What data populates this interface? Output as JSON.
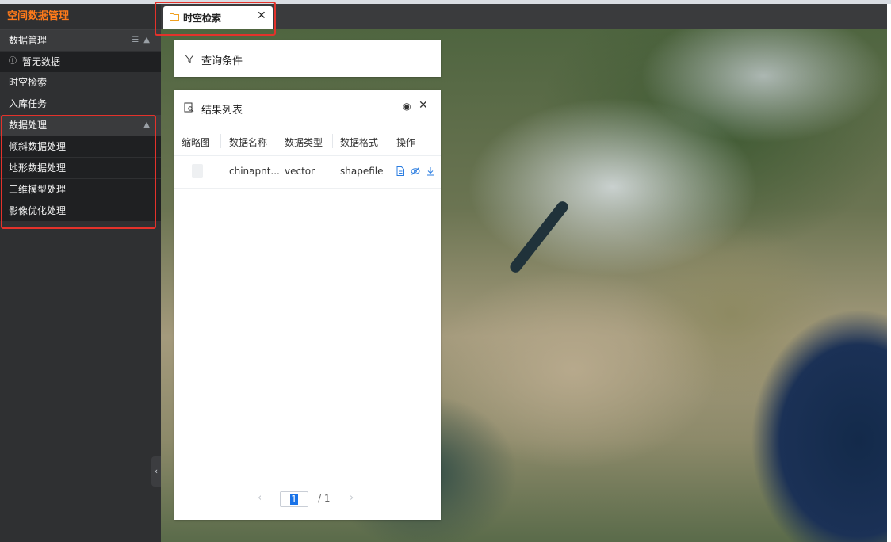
{
  "sidebar": {
    "app_title": "空间数据管理",
    "group_data_management": "数据管理",
    "no_data": "暂无数据",
    "items": [
      "时空检索",
      "入库任务"
    ],
    "group_data_processing": "数据处理",
    "processing_items": [
      "倾斜数据处理",
      "地形数据处理",
      "三维模型处理",
      "影像优化处理"
    ]
  },
  "tabs": [
    {
      "label": "时空检索"
    }
  ],
  "query_panel": {
    "title": "查询条件"
  },
  "results_panel": {
    "title": "结果列表",
    "columns": [
      "缩略图",
      "数据名称",
      "数据类型",
      "数据格式",
      "操作"
    ],
    "rows": [
      {
        "name": "chinapnt...",
        "type": "vector",
        "format": "shapefile"
      }
    ]
  },
  "pagination": {
    "current": "1",
    "total": "/ 1"
  },
  "colors": {
    "accent": "#ff7a1a",
    "sidebar_bg": "#2f3032",
    "highlight": "#e4322b",
    "link": "#2b7de1"
  }
}
